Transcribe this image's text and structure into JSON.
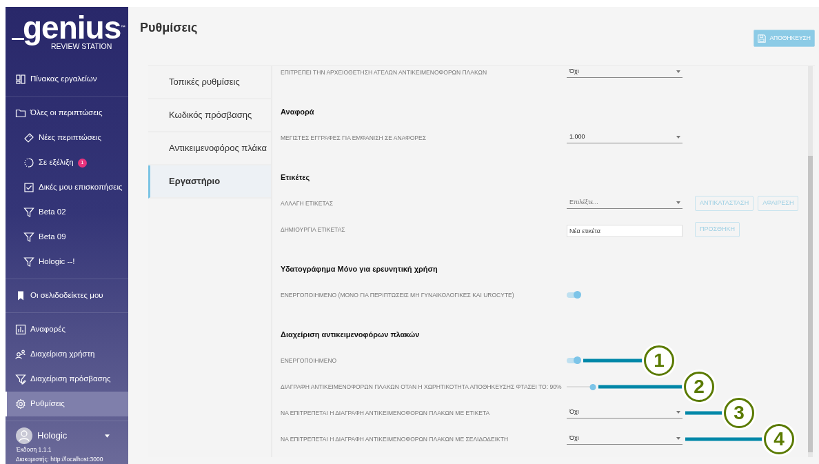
{
  "sidebar": {
    "logo": {
      "name": "genius",
      "trademark": "™",
      "subtitle": "REVIEW STATION"
    },
    "groups": [
      [
        {
          "kind": "dashboard",
          "label": "Πίνακας εργαλείων",
          "selected": false
        }
      ],
      [
        {
          "kind": "folder",
          "label": "Όλες οι περιπτώσεις",
          "selected": false,
          "children": [
            {
              "kind": "tag",
              "label": "Νέες περιπτώσεις",
              "selected": false
            },
            {
              "kind": "spinner",
              "label": "Σε εξέλιξη",
              "badge": "1",
              "selected": false
            },
            {
              "kind": "checkbox",
              "label": "Δικές μου επισκοπήσεις",
              "selected": false
            },
            {
              "kind": "filter",
              "label": "Beta 02",
              "selected": false
            },
            {
              "kind": "filter",
              "label": "Beta 09",
              "selected": false
            },
            {
              "kind": "filter",
              "label": "Hologic --!",
              "selected": false
            }
          ]
        }
      ],
      [
        {
          "kind": "bookmark",
          "label": "Οι σελιδοδείκτες μου",
          "selected": false
        }
      ],
      [
        {
          "kind": "chart",
          "label": "Αναφορές",
          "selected": false
        },
        {
          "kind": "users",
          "label": "Διαχείριση χρήστη",
          "selected": false
        },
        {
          "kind": "filter-edit",
          "label": "Διαχείριση πρόσβασης",
          "selected": false
        },
        {
          "kind": "gear",
          "label": "Ρυθμίσεις",
          "selected": true
        }
      ]
    ],
    "user": {
      "name": "Hologic",
      "version": "Έκδοση 1.1.1",
      "server": "Διακομιστής: http://localhost:3000"
    }
  },
  "page": {
    "title": "Ρυθμίσεις",
    "save_button": "ΑΠΟΘΗΚΕΥΣΗ"
  },
  "tabs": [
    {
      "label": "Τοπικές ρυθμίσεις",
      "selected": false
    },
    {
      "label": "Κωδικός πρόσβασης",
      "selected": false
    },
    {
      "label": "Αντικειμενοφόρος πλάκα",
      "selected": false
    },
    {
      "label": "Εργαστήριο",
      "selected": true
    }
  ],
  "rows": [
    {
      "kind": "select",
      "label": "ΕΠΙΤΡΕΠΕΙ ΤΗΝ ΑΡΧΕΙΟΘΕΤΗΣΗ ΑΤΕΛΩΝ ΑΝΤΙΚΕΙΜΕΝΟΦΟΡΩΝ ΠΛΑΚΩΝ",
      "value": "Όχι"
    },
    {
      "kind": "heading",
      "text": "Αναφορά"
    },
    {
      "kind": "select",
      "label": "ΜΕΓΙΣΤΕΣ ΕΓΓΡΑΦΕΣ ΓΙΑ ΕΜΦΑΝΙΣΗ ΣΕ ΑΝΑΦΟΡΕΣ",
      "value": "1.000"
    },
    {
      "kind": "heading",
      "text": "Ετικέτες"
    },
    {
      "kind": "select",
      "label": "ΑΛΛΑΓΗ ΕΤΙΚΕΤΑΣ",
      "placeholder": "Επιλέξτε...",
      "buttons": [
        "ΑΝΤΙΚΑΤΑΣΤΑΣΗ",
        "ΑΦΑΙΡΕΣΗ"
      ]
    },
    {
      "kind": "input",
      "label": "ΔΗΜΙΟΥΡΓΙΑ ΕΤΙΚΕΤΑΣ",
      "placeholder": "Νέα ετικέτα",
      "buttons": [
        "ΠΡΟΣΘΗΚΗ"
      ]
    },
    {
      "kind": "heading",
      "text": "Υδατογράφημα Μόνο για ερευνητική χρήση"
    },
    {
      "kind": "toggle",
      "label": "ΕΝΕΡΓΟΠΟΙΗΜΕΝΟ (ΜΟΝΟ ΓΙΑ ΠΕΡΙΠΤΩΣΕΙΣ ΜΗ ΓΥΝΑΙΚΟΛΟΓΙΚΕΣ ΚΑΙ UROCYTE)",
      "on": true
    },
    {
      "kind": "heading",
      "text": "Διαχείριση αντικειμενοφόρων πλακών"
    },
    {
      "kind": "toggle",
      "label": "ΕΝΕΡΓΟΠΟΙΗΜΕΝΟ",
      "on": true,
      "callout": "1"
    },
    {
      "kind": "slider",
      "label": "ΔΙΑΓΡΑΦΗ ΑΝΤΙΚΕΙΜΕΝΟΦΟΡΩΝ ΠΛΑΚΩΝ ΟΤΑΝ Η ΧΩΡΗΤΙΚΟΤΗΤΑ ΑΠΟΘΗΚΕΥΣΗΣ ΦΤΑΣΕΙ ΤΟ: 90%",
      "level": 0.9,
      "callout": "2"
    },
    {
      "kind": "select",
      "label": "ΝΑ ΕΠΙΤΡΕΠΕΤΑΙ Η ΔΙΑΓΡΑΦΗ ΑΝΤΙΚΕΙΜΕΝΟΦΟΡΩΝ ΠΛΑΚΩΝ ΜΕ ΕΤΙΚΕΤΑ",
      "value": "Όχι",
      "callout": "3"
    },
    {
      "kind": "select",
      "label": "ΝΑ ΕΠΙΤΡΕΠΕΤΑΙ Η ΔΙΑΓΡΑΦΗ ΑΝΤΙΚΕΙΜΕΝΟΦΟΡΩΝ ΠΛΑΚΩΝ ΜΕ ΣΕΛΙΔΟΔΕΙΚΤΗ",
      "value": "Όχι",
      "callout": "4"
    }
  ]
}
